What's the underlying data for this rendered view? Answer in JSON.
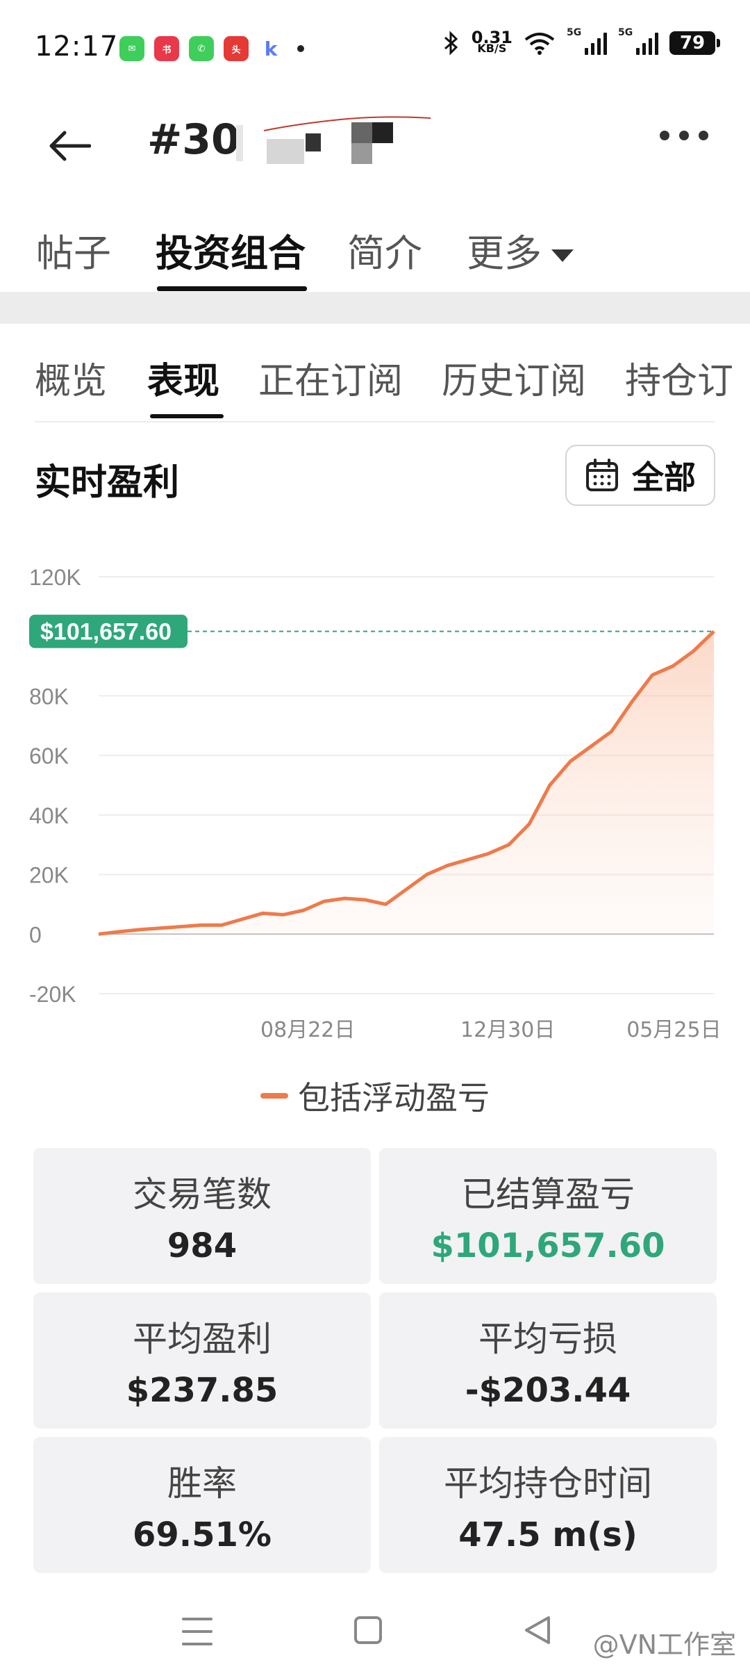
{
  "status_bar": {
    "time": "12:17",
    "net_speed_value": "0.31",
    "net_speed_unit": "KB/S",
    "signal1": "5G",
    "signal2": "5G",
    "battery": "79",
    "app_icons": [
      "messages-icon",
      "xiaohongshu-icon",
      "phone-icon",
      "toutiao-icon",
      "kuaishou-icon"
    ]
  },
  "header": {
    "title": "#30"
  },
  "main_tabs": [
    "帖子",
    "投资组合",
    "简介",
    "更多"
  ],
  "sub_tabs": [
    "概览",
    "表现",
    "正在订阅",
    "历史订阅",
    "持仓订"
  ],
  "section": {
    "title": "实时盈利",
    "range_label": "全部"
  },
  "chart_data": {
    "type": "area",
    "current_value_label": "$101,657.60",
    "y_tick_labels": [
      "120K",
      "80K",
      "60K",
      "40K",
      "20K",
      "0",
      "-20K"
    ],
    "x_tick_labels": [
      "08月22日",
      "12月30日",
      "05月25日"
    ],
    "ylim": [
      -20000,
      120000
    ],
    "series": [
      {
        "name": "包括浮动盈亏",
        "color": "#ef7a4a",
        "values": [
          0,
          800,
          1500,
          2000,
          2500,
          3000,
          3000,
          5000,
          7000,
          6500,
          8000,
          11000,
          12000,
          11500,
          10000,
          15000,
          20000,
          23000,
          25000,
          27000,
          30000,
          37000,
          50000,
          58000,
          63000,
          68000,
          78000,
          87000,
          90000,
          95000,
          101657.6
        ]
      }
    ],
    "legend": "bottom-center",
    "grid": true
  },
  "stats": [
    {
      "label": "交易笔数",
      "value": "984",
      "color": "default"
    },
    {
      "label": "已结算盈亏",
      "value": "$101,657.60",
      "color": "green"
    },
    {
      "label": "平均盈利",
      "value": "$237.85",
      "color": "default"
    },
    {
      "label": "平均亏损",
      "value": "-$203.44",
      "color": "default"
    },
    {
      "label": "胜率",
      "value": "69.51%",
      "color": "default"
    },
    {
      "label": "平均持仓时间",
      "value": "47.5 m(s)",
      "color": "default"
    }
  ],
  "watermark": "@VN工作室",
  "colors": {
    "accent_green": "#2ea77a",
    "line_orange": "#ef7a4a",
    "area_fill": "#fde3d6"
  }
}
